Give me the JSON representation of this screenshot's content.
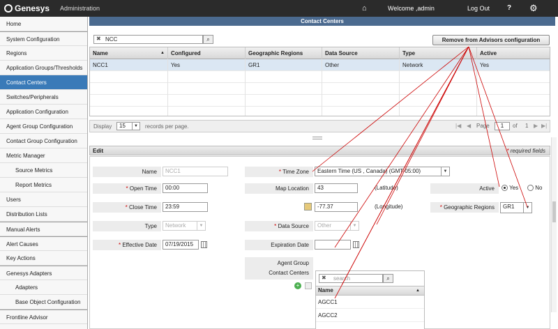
{
  "header": {
    "brand": "Genesys",
    "section": "Administration",
    "welcome": "Welcome ,admin",
    "logout": "Log Out",
    "help": "?"
  },
  "sidebar": {
    "items": [
      {
        "label": "Home"
      },
      {
        "label": "System Configuration"
      },
      {
        "label": "Regions"
      },
      {
        "label": "Application Groups/Thresholds"
      },
      {
        "label": "Contact Centers"
      },
      {
        "label": "Switches/Peripherals"
      },
      {
        "label": "Application Configuration"
      },
      {
        "label": "Agent Group Configuration"
      },
      {
        "label": "Contact Group Configuration"
      },
      {
        "label": "Metric Manager"
      },
      {
        "label": "Source Metrics"
      },
      {
        "label": "Report Metrics"
      },
      {
        "label": "Users"
      },
      {
        "label": "Distribution Lists"
      },
      {
        "label": "Manual Alerts"
      },
      {
        "label": "Alert Causes"
      },
      {
        "label": "Key Actions"
      },
      {
        "label": "Genesys Adapters"
      },
      {
        "label": "Adapters"
      },
      {
        "label": "Base Object Configuration"
      },
      {
        "label": "Frontline Advisor"
      }
    ]
  },
  "page": {
    "title": "Contact Centers",
    "search_value": "NCC",
    "remove_button": "Remove from Advisors configuration"
  },
  "table": {
    "columns": [
      "Name",
      "Configured",
      "Geographic Regions",
      "Data Source",
      "Type",
      "Active"
    ],
    "sort_indicator": "▲",
    "rows": [
      {
        "name": "NCC1",
        "configured": "Yes",
        "region": "GR1",
        "source": "Other",
        "type": "Network",
        "active": "Yes"
      }
    ]
  },
  "pager": {
    "display": "Display",
    "per_page": "15",
    "records": "records per page.",
    "page_label": "Page",
    "page": "1",
    "of": "of",
    "total": "1"
  },
  "edit": {
    "title": "Edit",
    "required": "required fields",
    "name_label": "Name",
    "name_value": "NCC1",
    "open_label": "Open Time",
    "open_value": "00:00",
    "close_label": "Close Time",
    "close_value": "23:59",
    "type_label": "Type",
    "type_value": "Network",
    "eff_label": "Effective Date",
    "eff_value": "07/19/2015",
    "tz_label": "Time Zone",
    "tz_value": "Eastern Time (US , Canada) (GMT-05:00)",
    "map_label": "Map Location",
    "lat_value": "43",
    "lat_note": "(Latitude)",
    "lon_value": "-77.37",
    "lon_note": "(Longitude)",
    "ds_label": "Data Source",
    "ds_value": "Other",
    "exp_label": "Expiration Date",
    "exp_value": "",
    "ag_label_1": "Agent Group",
    "ag_label_2": "Contact Centers",
    "ag_search_placeholder": "search",
    "ag_name_header": "Name",
    "ag_rows": [
      "AGCC1",
      "AGCC2"
    ],
    "active_label": "Active",
    "yes": "Yes",
    "no": "No",
    "geo_label": "Geographic Regions",
    "geo_value": "GR1"
  },
  "colors": {
    "accent": "#3a7ab8",
    "title_bar": "#4b6a8f",
    "annotation": "#cc0000"
  }
}
